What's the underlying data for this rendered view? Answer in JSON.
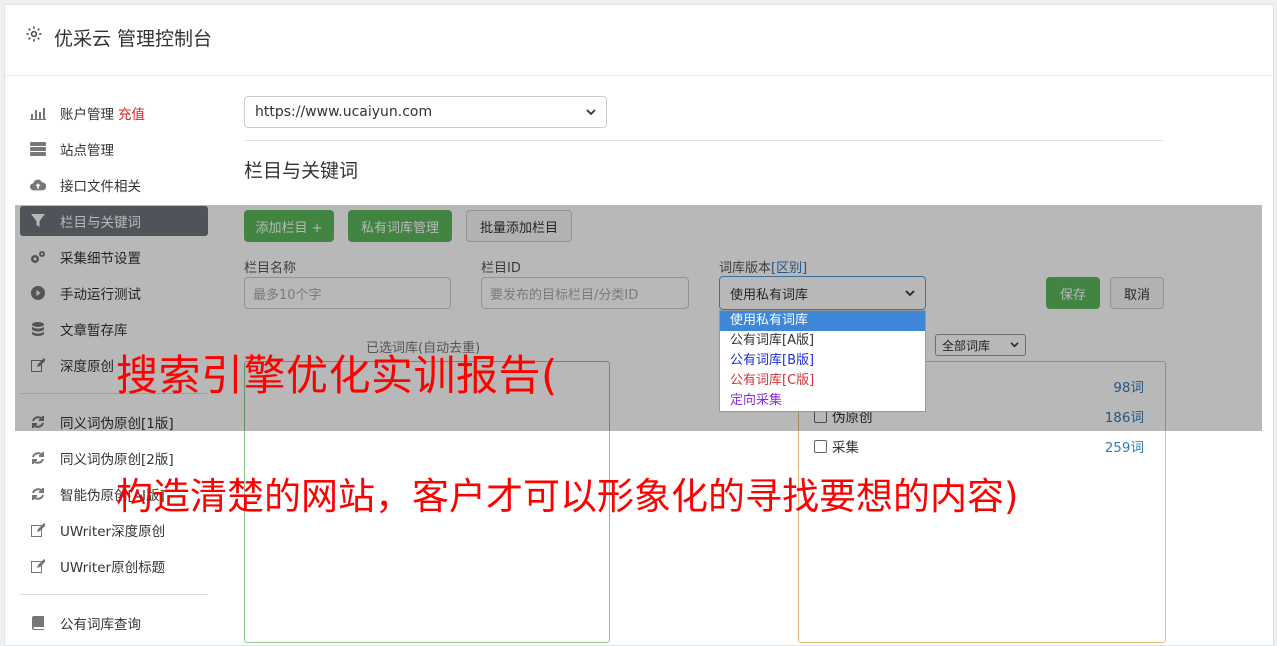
{
  "app": {
    "title": "优采云 管理控制台"
  },
  "sidebar": {
    "items": [
      {
        "label": "账户管理",
        "extra": "充值",
        "icon": "bar-chart-icon"
      },
      {
        "label": "站点管理",
        "icon": "server-icon"
      },
      {
        "label": "接口文件相关",
        "icon": "cloud-upload-icon"
      },
      {
        "label": "栏目与关键词",
        "icon": "filter-icon",
        "active": true
      },
      {
        "label": "采集细节设置",
        "icon": "cogs-icon"
      },
      {
        "label": "手动运行测试",
        "icon": "play-circle-icon"
      },
      {
        "label": "文章暂存库",
        "icon": "database-icon"
      },
      {
        "label": "深度原创",
        "icon": "edit-icon"
      },
      {
        "label": "同义词伪原创[1版]",
        "icon": "refresh-icon"
      },
      {
        "label": "同义词伪原创[2版]",
        "icon": "refresh-icon"
      },
      {
        "label": "智能伪原创[AI版]",
        "icon": "refresh-icon"
      },
      {
        "label": "UWriter深度原创",
        "icon": "edit-icon"
      },
      {
        "label": "UWriter原创标题",
        "icon": "edit-icon"
      },
      {
        "label": "公有词库查询",
        "icon": "book-icon"
      }
    ]
  },
  "site_select": {
    "value": "https://www.ucaiyun.com"
  },
  "section": {
    "title": "栏目与关键词"
  },
  "toolbar": {
    "add_column": "添加栏目 +",
    "private_lib": "私有词库管理",
    "batch_add": "批量添加栏目"
  },
  "form": {
    "name_label": "栏目名称",
    "name_placeholder": "最多10个字",
    "id_label": "栏目ID",
    "id_placeholder": "要发布的目标栏目/分类ID",
    "version_label": "词库版本",
    "version_link": "[区别]",
    "version_value": "使用私有词库",
    "save": "保存",
    "cancel": "取消"
  },
  "dropdown": {
    "options": [
      {
        "label": "使用私有词库",
        "color": "#ffffff",
        "selected": true
      },
      {
        "label": "公有词库[A版]",
        "color": "#333333"
      },
      {
        "label": "公有词库[B版]",
        "color": "#1f2ccf"
      },
      {
        "label": "公有词库[C版]",
        "color": "#d0343a"
      },
      {
        "label": "定向采集",
        "color": "#8a2be2"
      }
    ]
  },
  "selected_lib": {
    "title": "已选词库(自动去重)"
  },
  "all_libs": {
    "filter": "全部词库",
    "rows": [
      {
        "name": "",
        "count": "98词"
      },
      {
        "name": "伪原创",
        "count": "186词"
      },
      {
        "name": "采集",
        "count": "259词"
      }
    ]
  },
  "watermark": {
    "line1": "搜索引擎优化实训报告(",
    "line2": "构造清楚的网站，客户才可以形象化的寻找要想的内容)"
  }
}
